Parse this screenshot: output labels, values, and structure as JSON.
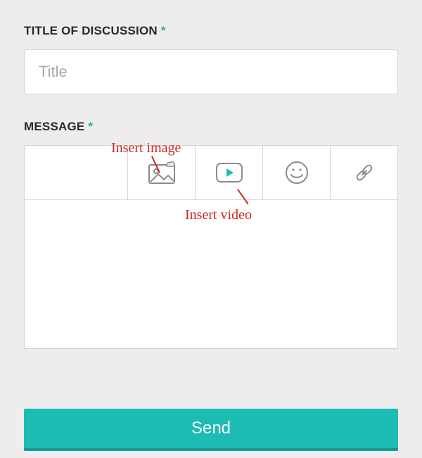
{
  "title_field": {
    "label": "TITLE OF DISCUSSION",
    "required_mark": "*",
    "placeholder": "Title",
    "value": ""
  },
  "message_field": {
    "label": "MESSAGE",
    "required_mark": "*",
    "value": ""
  },
  "toolbar": {
    "image_icon": "insert-image",
    "video_icon": "insert-video",
    "emoji_icon": "insert-emoji",
    "link_icon": "insert-link"
  },
  "send_button": {
    "label": "Send"
  },
  "annotations": {
    "insert_image": "Insert image",
    "insert_video": "Insert video"
  }
}
